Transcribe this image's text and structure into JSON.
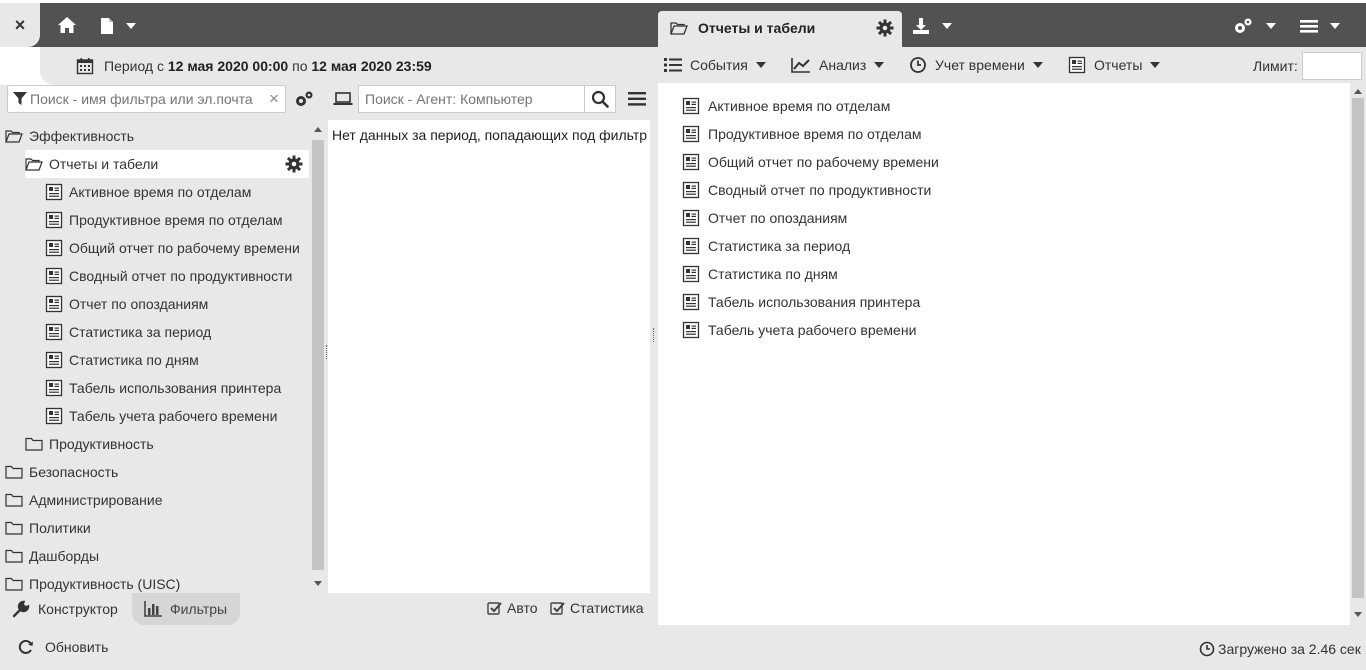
{
  "topbar": {
    "close_label": "×",
    "main_tab_label": "Отчеты и табели"
  },
  "period": {
    "prefix": "Период с",
    "from": "12 мая 2020 00:00",
    "middle": "по",
    "to": "12 мая 2020 23:59"
  },
  "right_menu": {
    "events": "События",
    "analysis": "Анализ",
    "time_tracking": "Учет времени",
    "reports": "Отчеты",
    "limit_label": "Лимит:",
    "limit_value": ""
  },
  "left_search": {
    "placeholder": "Поиск - имя фильтра или эл.почта",
    "clear": "×"
  },
  "tree": {
    "root": "Эффективность",
    "selected_folder": "Отчеты и табели",
    "reports": [
      "Активное время по отделам",
      "Продуктивное время по отделам",
      "Общий отчет по рабочему времени",
      "Сводный отчет по продуктивности",
      "Отчет по опозданиям",
      "Статистика за период",
      "Статистика по дням",
      "Табель использования принтера",
      "Табель учета рабочего времени"
    ],
    "productivity": "Продуктивность",
    "folders": [
      "Безопасность",
      "Администрирование",
      "Политики",
      "Дашборды",
      "Продуктивность (UISC)"
    ]
  },
  "bottom_tabs": {
    "constructor": "Конструктор",
    "filters": "Фильтры"
  },
  "middle": {
    "search_placeholder": "Поиск - Агент: Компьютер",
    "empty_message": "Нет данных за период, попадающих под фильтр",
    "auto": "Авто",
    "stats": "Статистика"
  },
  "right_list": [
    "Активное время по отделам",
    "Продуктивное время по отделам",
    "Общий отчет по рабочему времени",
    "Сводный отчет по продуктивности",
    "Отчет по опозданиям",
    "Статистика за период",
    "Статистика по дням",
    "Табель использования принтера",
    "Табель учета рабочего времени"
  ],
  "footer": {
    "refresh": "Обновить",
    "loaded": "Загружено за 2.46 сек"
  }
}
